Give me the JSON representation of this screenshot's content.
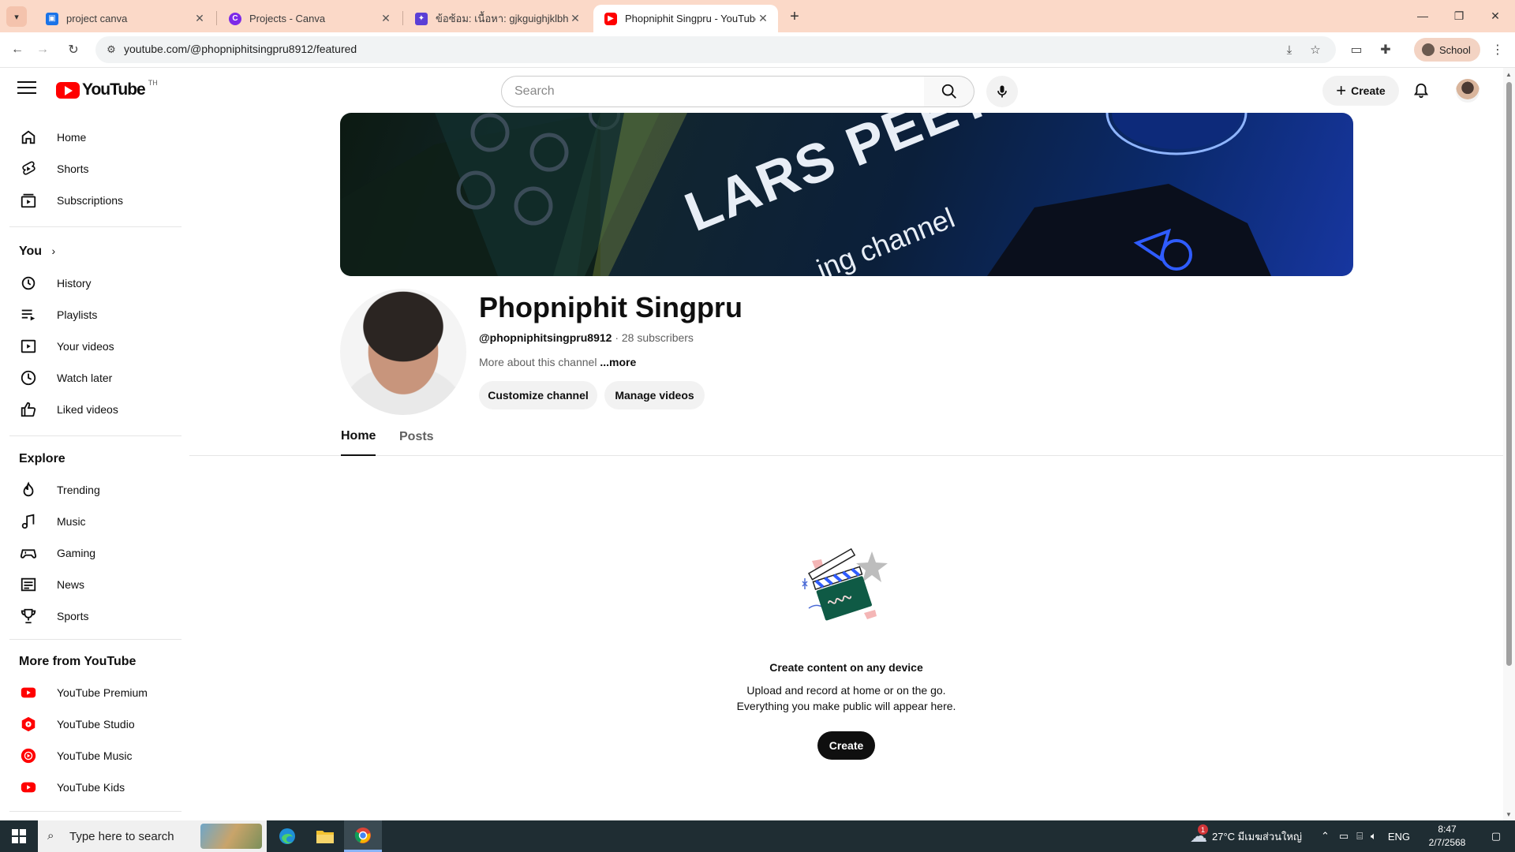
{
  "browser": {
    "tabs": [
      {
        "title": "project canva",
        "icon": "canva-classroom-icon",
        "color": "#1a73e8"
      },
      {
        "title": "Projects - Canva",
        "icon": "canva-icon",
        "color": "#7d2ae8"
      },
      {
        "title": "ข้อซ้อม: เนื้อหา: gjkguighjklbhuiog",
        "icon": "chat-icon",
        "color": "#5a3fd6"
      },
      {
        "title": "Phopniphit Singpru - YouTube",
        "icon": "youtube-icon",
        "color": "#ff0000"
      }
    ],
    "url": "youtube.com/@phopniphitsingpru8912/featured",
    "profile_label": "School"
  },
  "youtube": {
    "logo_text": "YouTube",
    "country_code": "TH",
    "search_placeholder": "Search",
    "create_label": "Create",
    "sidebar": {
      "main": [
        {
          "label": "Home",
          "icon": "home-icon"
        },
        {
          "label": "Shorts",
          "icon": "shorts-icon"
        },
        {
          "label": "Subscriptions",
          "icon": "subscriptions-icon"
        }
      ],
      "you_header": "You",
      "you": [
        {
          "label": "History",
          "icon": "history-icon"
        },
        {
          "label": "Playlists",
          "icon": "playlists-icon"
        },
        {
          "label": "Your videos",
          "icon": "your-videos-icon"
        },
        {
          "label": "Watch later",
          "icon": "watch-later-icon"
        },
        {
          "label": "Liked videos",
          "icon": "liked-videos-icon"
        }
      ],
      "explore_header": "Explore",
      "explore": [
        {
          "label": "Trending",
          "icon": "trending-icon"
        },
        {
          "label": "Music",
          "icon": "music-icon"
        },
        {
          "label": "Gaming",
          "icon": "gaming-icon"
        },
        {
          "label": "News",
          "icon": "news-icon"
        },
        {
          "label": "Sports",
          "icon": "sports-icon"
        }
      ],
      "more_header": "More from YouTube",
      "more": [
        {
          "label": "YouTube Premium",
          "icon": "youtube-premium-icon"
        },
        {
          "label": "YouTube Studio",
          "icon": "youtube-studio-icon"
        },
        {
          "label": "YouTube Music",
          "icon": "youtube-music-icon"
        },
        {
          "label": "YouTube Kids",
          "icon": "youtube-kids-icon"
        }
      ]
    },
    "channel": {
      "banner_text_1": "LARS PEETERS",
      "banner_text_2": "ing channel",
      "name": "Phopniphit Singpru",
      "handle": "@phopniphitsingpru8912",
      "subscribers": "28 subscribers",
      "about": "More about this channel",
      "about_more": "...more",
      "customize_label": "Customize channel",
      "manage_label": "Manage videos",
      "tabs": [
        "Home",
        "Posts"
      ],
      "active_tab": "Home"
    },
    "empty_state": {
      "title": "Create content on any device",
      "line1": "Upload and record at home or on the go.",
      "line2": "Everything you make public will appear here.",
      "button": "Create"
    }
  },
  "taskbar": {
    "search_placeholder": "Type here to search",
    "weather": "27°C มีเมฆส่วนใหญ่",
    "weather_badge": "1",
    "language": "ENG",
    "time": "8:47",
    "date": "2/7/2568"
  }
}
